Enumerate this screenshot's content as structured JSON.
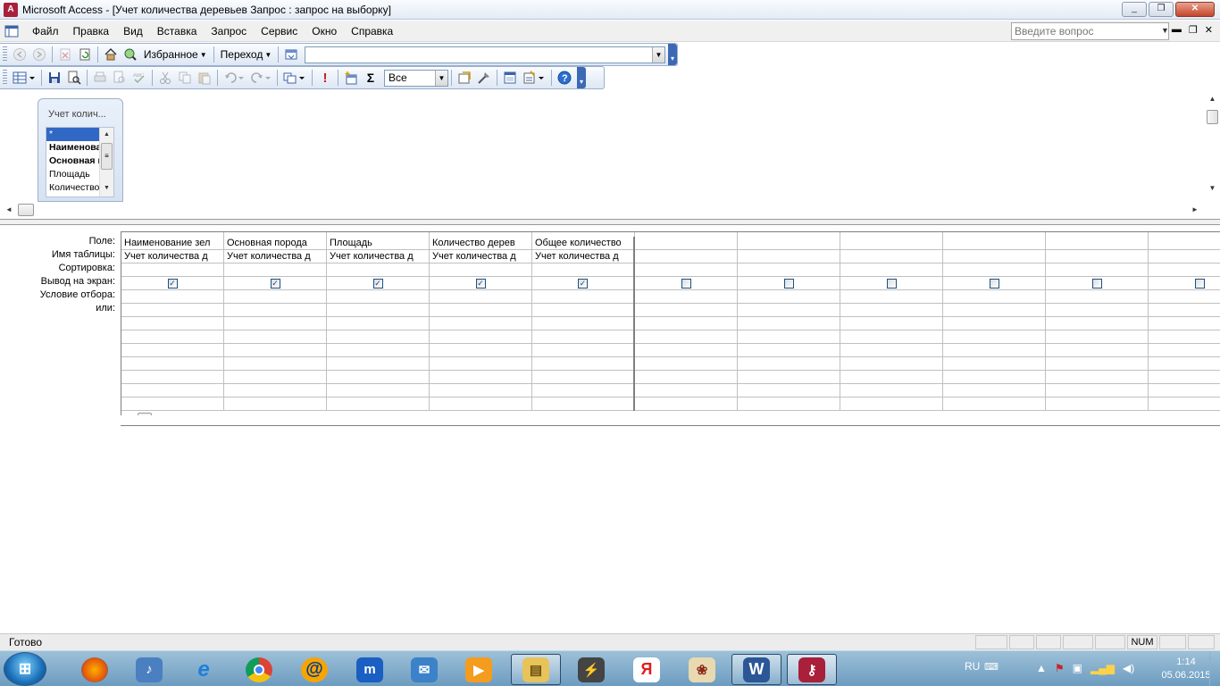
{
  "window": {
    "title": "Microsoft Access - [Учет количества деревьев Запрос : запрос на выборку]",
    "controls": [
      "_",
      "❐",
      "✕"
    ]
  },
  "menubar": {
    "items": [
      "Файл",
      "Правка",
      "Вид",
      "Вставка",
      "Запрос",
      "Сервис",
      "Окно",
      "Справка"
    ],
    "help_placeholder": "Введите вопрос"
  },
  "web_toolbar": {
    "favorites_label": "Избранное",
    "goto_label": "Переход",
    "address_value": ""
  },
  "query_toolbar": {
    "top_values": "Все",
    "sigma": "Σ",
    "exclamation": "!"
  },
  "table_box": {
    "title": "Учет колич...",
    "fields": [
      "*",
      "Наименование",
      "Основная порода",
      "Площадь",
      "Количество"
    ]
  },
  "qbe": {
    "row_labels": [
      "Поле:",
      "Имя таблицы:",
      "Сортировка:",
      "Вывод на экран:",
      "Условие отбора:",
      "или:"
    ],
    "columns": [
      {
        "field": "Наименование зел",
        "table": "Учет количества д",
        "show": true
      },
      {
        "field": "Основная порода",
        "table": "Учет количества д",
        "show": true
      },
      {
        "field": "Площадь",
        "table": "Учет количества д",
        "show": true
      },
      {
        "field": "Количество дерев",
        "table": "Учет количества д",
        "show": true
      },
      {
        "field": "Общее количество",
        "table": "Учет количества д",
        "show": true
      },
      {
        "field": "",
        "table": "",
        "show": false
      },
      {
        "field": "",
        "table": "",
        "show": false
      },
      {
        "field": "",
        "table": "",
        "show": false
      },
      {
        "field": "",
        "table": "",
        "show": false
      },
      {
        "field": "",
        "table": "",
        "show": false
      },
      {
        "field": "",
        "table": "",
        "show": false
      }
    ],
    "check_mark": "✓"
  },
  "status": {
    "text": "Готово",
    "num": "NUM"
  },
  "taskbar": {
    "lang": "RU",
    "time": "1:14",
    "date": "05.06.2015",
    "apps": [
      "firefox-icon",
      "volume-icon",
      "ie-icon",
      "chrome-icon",
      "mail-ru-icon",
      "maxthon-icon",
      "mail-icon",
      "media-player-icon",
      "explorer-icon",
      "winamp-icon",
      "yandex-icon",
      "mahjong-icon",
      "word-icon",
      "access-icon"
    ]
  },
  "colors": {
    "selection": "#3168c6",
    "access_brand": "#a8203a"
  }
}
